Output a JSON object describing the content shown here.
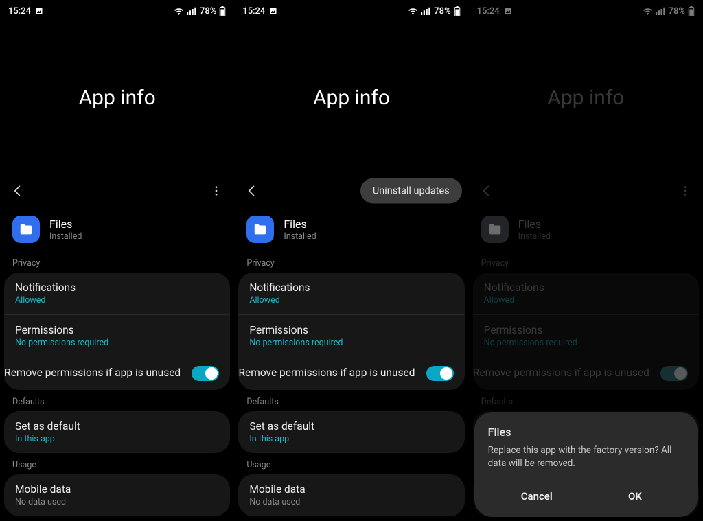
{
  "status": {
    "time": "15:24",
    "battery_text": "78%"
  },
  "hero": {
    "title": "App info"
  },
  "toolbar": {
    "uninstall_updates": "Uninstall updates"
  },
  "app": {
    "name": "Files",
    "status": "Installed"
  },
  "sections": {
    "privacy": "Privacy",
    "defaults": "Defaults",
    "usage": "Usage"
  },
  "rows": {
    "notifications": {
      "title": "Notifications",
      "sub": "Allowed"
    },
    "permissions": {
      "title": "Permissions",
      "sub": "No permissions required"
    },
    "remove_perms": {
      "title": "Remove permissions if app is unused"
    },
    "set_default": {
      "title": "Set as default",
      "sub": "In this app"
    },
    "mobile_data": {
      "title": "Mobile data",
      "sub": "No data used"
    }
  },
  "dialog": {
    "title": "Files",
    "body": "Replace this app with the factory version? All data will be removed.",
    "cancel": "Cancel",
    "ok": "OK"
  }
}
